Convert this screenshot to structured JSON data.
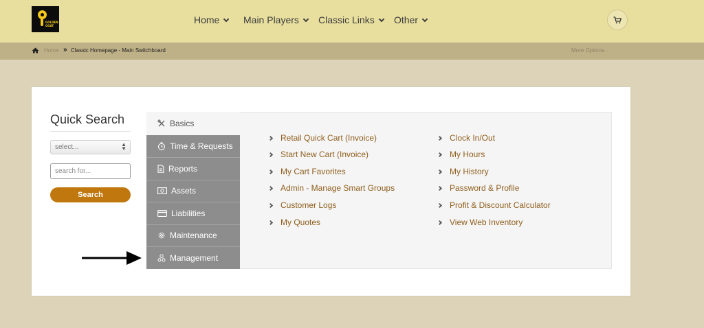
{
  "brand": {
    "logo_text": "GOLDEN GOAT"
  },
  "nav": {
    "items": [
      {
        "label": "Home"
      },
      {
        "label": "Main Players"
      },
      {
        "label": "Classic Links"
      },
      {
        "label": "Other"
      }
    ],
    "cart_icon": "cart-icon"
  },
  "breadcrumb": {
    "home": "Home",
    "current": "Classic Homepage - Main Switchboard",
    "more": "More Options..."
  },
  "quick_search": {
    "title": "Quick Search",
    "select_value": "select...",
    "search_placeholder": "search for...",
    "button_label": "Search"
  },
  "menu": {
    "tabs": [
      {
        "label": "Basics",
        "icon": "tools-icon",
        "active": true
      },
      {
        "label": "Time & Requests",
        "icon": "stopwatch-icon"
      },
      {
        "label": "Reports",
        "icon": "report-icon"
      },
      {
        "label": "Assets",
        "icon": "money-icon"
      },
      {
        "label": "Liabilities",
        "icon": "credit-card-icon"
      },
      {
        "label": "Maintenance",
        "icon": "gear-icon"
      },
      {
        "label": "Management",
        "icon": "users-icon"
      }
    ],
    "links_col1": [
      "Retail Quick Cart (Invoice)",
      "Start New Cart (Invoice)",
      "My Cart Favorites",
      "Admin - Manage Smart Groups",
      "Customer Logs",
      "My Quotes"
    ],
    "links_col2": [
      "Clock In/Out",
      "My Hours",
      "My History",
      "Password & Profile",
      "Profit & Discount Calculator",
      "View Web Inventory"
    ]
  },
  "colors": {
    "topbar": "#e8df9f",
    "breadcrumb_bar": "#bfb187",
    "background": "#dcd3b9",
    "accent_button": "#c0770d",
    "link_text": "#8f5e1c",
    "sidebar": "#8d8d8d"
  }
}
